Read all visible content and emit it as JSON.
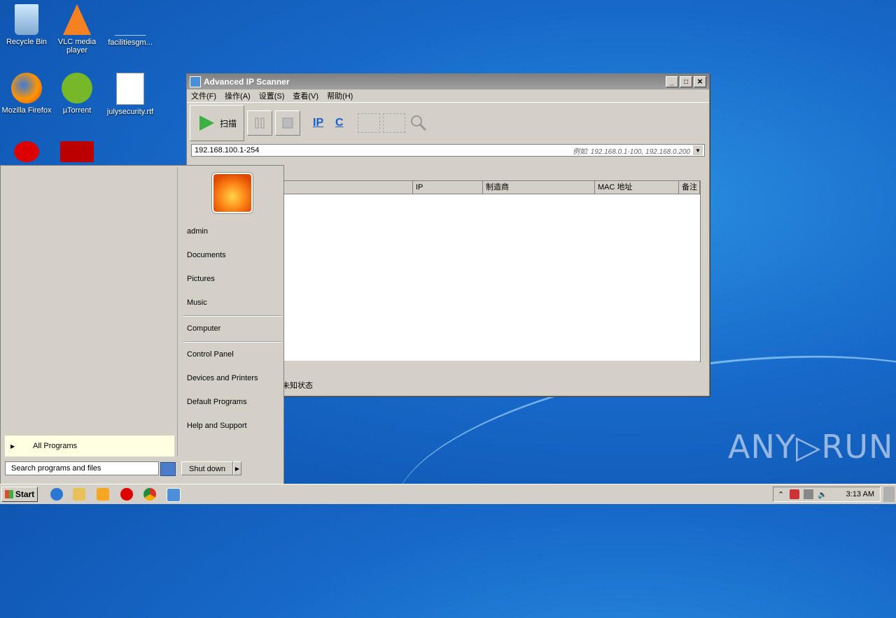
{
  "desktop": {
    "icons": [
      {
        "label": "Recycle Bin"
      },
      {
        "label": "VLC media player"
      },
      {
        "label": "facilitiesgm..."
      },
      {
        "label": "Mozilla Firefox"
      },
      {
        "label": "µTorrent"
      },
      {
        "label": "julysecurity.rtf"
      }
    ],
    "watermark": "ANY▷RUN"
  },
  "window": {
    "title": "Advanced IP Scanner",
    "controls": {
      "minimize": "_",
      "maximize": "□",
      "close": "✕"
    },
    "menu": [
      "文件(F)",
      "操作(A)",
      "设置(S)",
      "查看(V)",
      "帮助(H)"
    ],
    "toolbar": {
      "scan_label": "扫描",
      "ip_label": "IP",
      "c_label": "C"
    },
    "address": {
      "value": "192.168.100.1-254",
      "hint": "例如: 192.168.0.1-100, 192.168.0.200"
    },
    "columns": [
      "",
      "IP",
      "制造商",
      "MAC 地址",
      "备注"
    ],
    "status": "未知状态"
  },
  "start_menu": {
    "user": "admin",
    "items": [
      "Documents",
      "Pictures",
      "Music",
      "Computer",
      "Control Panel",
      "Devices and Printers",
      "Default Programs",
      "Help and Support"
    ],
    "all_programs": "All Programs",
    "search_placeholder": "Search programs and files",
    "shutdown": "Shut down"
  },
  "taskbar": {
    "start_label": "Start",
    "clock": "3:13 AM"
  }
}
